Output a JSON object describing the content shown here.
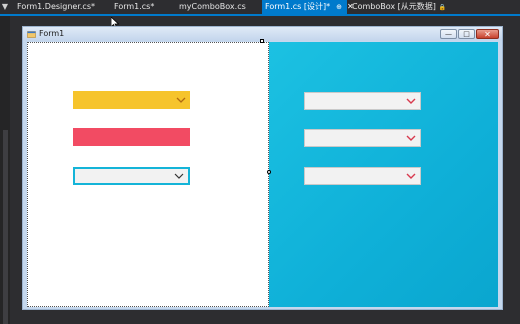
{
  "ide": {
    "side_button": "▼",
    "tabs": [
      {
        "label": "Form1.Designer.cs*",
        "active": false
      },
      {
        "label": "Form1.cs*",
        "active": false
      },
      {
        "label": "myComboBox.cs",
        "active": false
      },
      {
        "label": "Form1.cs [设计]*",
        "active": true,
        "pin": "⊕",
        "close": "✕"
      },
      {
        "label": "ComboBox [从元数据]",
        "active": false,
        "lock": "🔒"
      }
    ]
  },
  "form": {
    "title": "Form1",
    "icon": "form-icon",
    "window_buttons": {
      "minimize": "—",
      "maximize": "□",
      "close": "✕"
    }
  },
  "colors": {
    "accent": "#007acc",
    "yellow": "#f6c42c",
    "red": "#f24b63",
    "cyan_panel": "#13b8de",
    "caret": "#d83a4e"
  },
  "combos": [
    {
      "id": "yellow-combo",
      "value": ""
    },
    {
      "id": "red-combo",
      "value": ""
    },
    {
      "id": "cyan-border-combo",
      "value": ""
    },
    {
      "id": "right-combo-1",
      "value": ""
    },
    {
      "id": "right-combo-2",
      "value": ""
    },
    {
      "id": "right-combo-3",
      "value": ""
    }
  ]
}
